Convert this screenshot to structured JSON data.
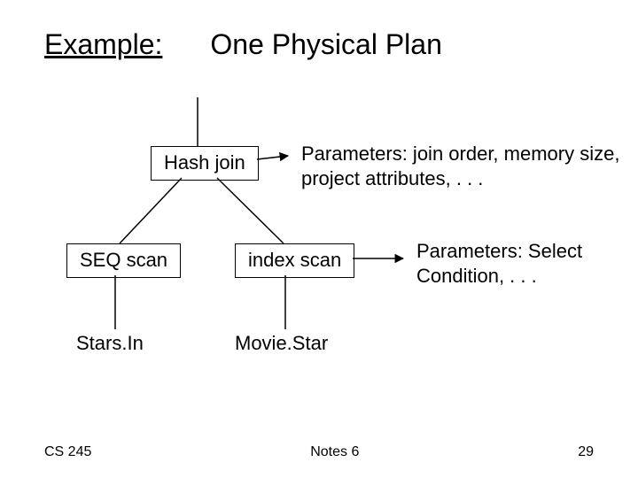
{
  "title": {
    "example_label": "Example:",
    "main": "One Physical Plan"
  },
  "nodes": {
    "hash_join": "Hash join",
    "seq_scan": "SEQ scan",
    "index_scan": "index scan",
    "stars_in": "Stars.In",
    "movie_star": "Movie.Star"
  },
  "annotations": {
    "hash_join_params": "Parameters: join order, memory size, project attributes, . . .",
    "index_scan_params": "Parameters: Select Condition, . . ."
  },
  "footer": {
    "left": "CS 245",
    "center": "Notes 6",
    "right": "29"
  }
}
